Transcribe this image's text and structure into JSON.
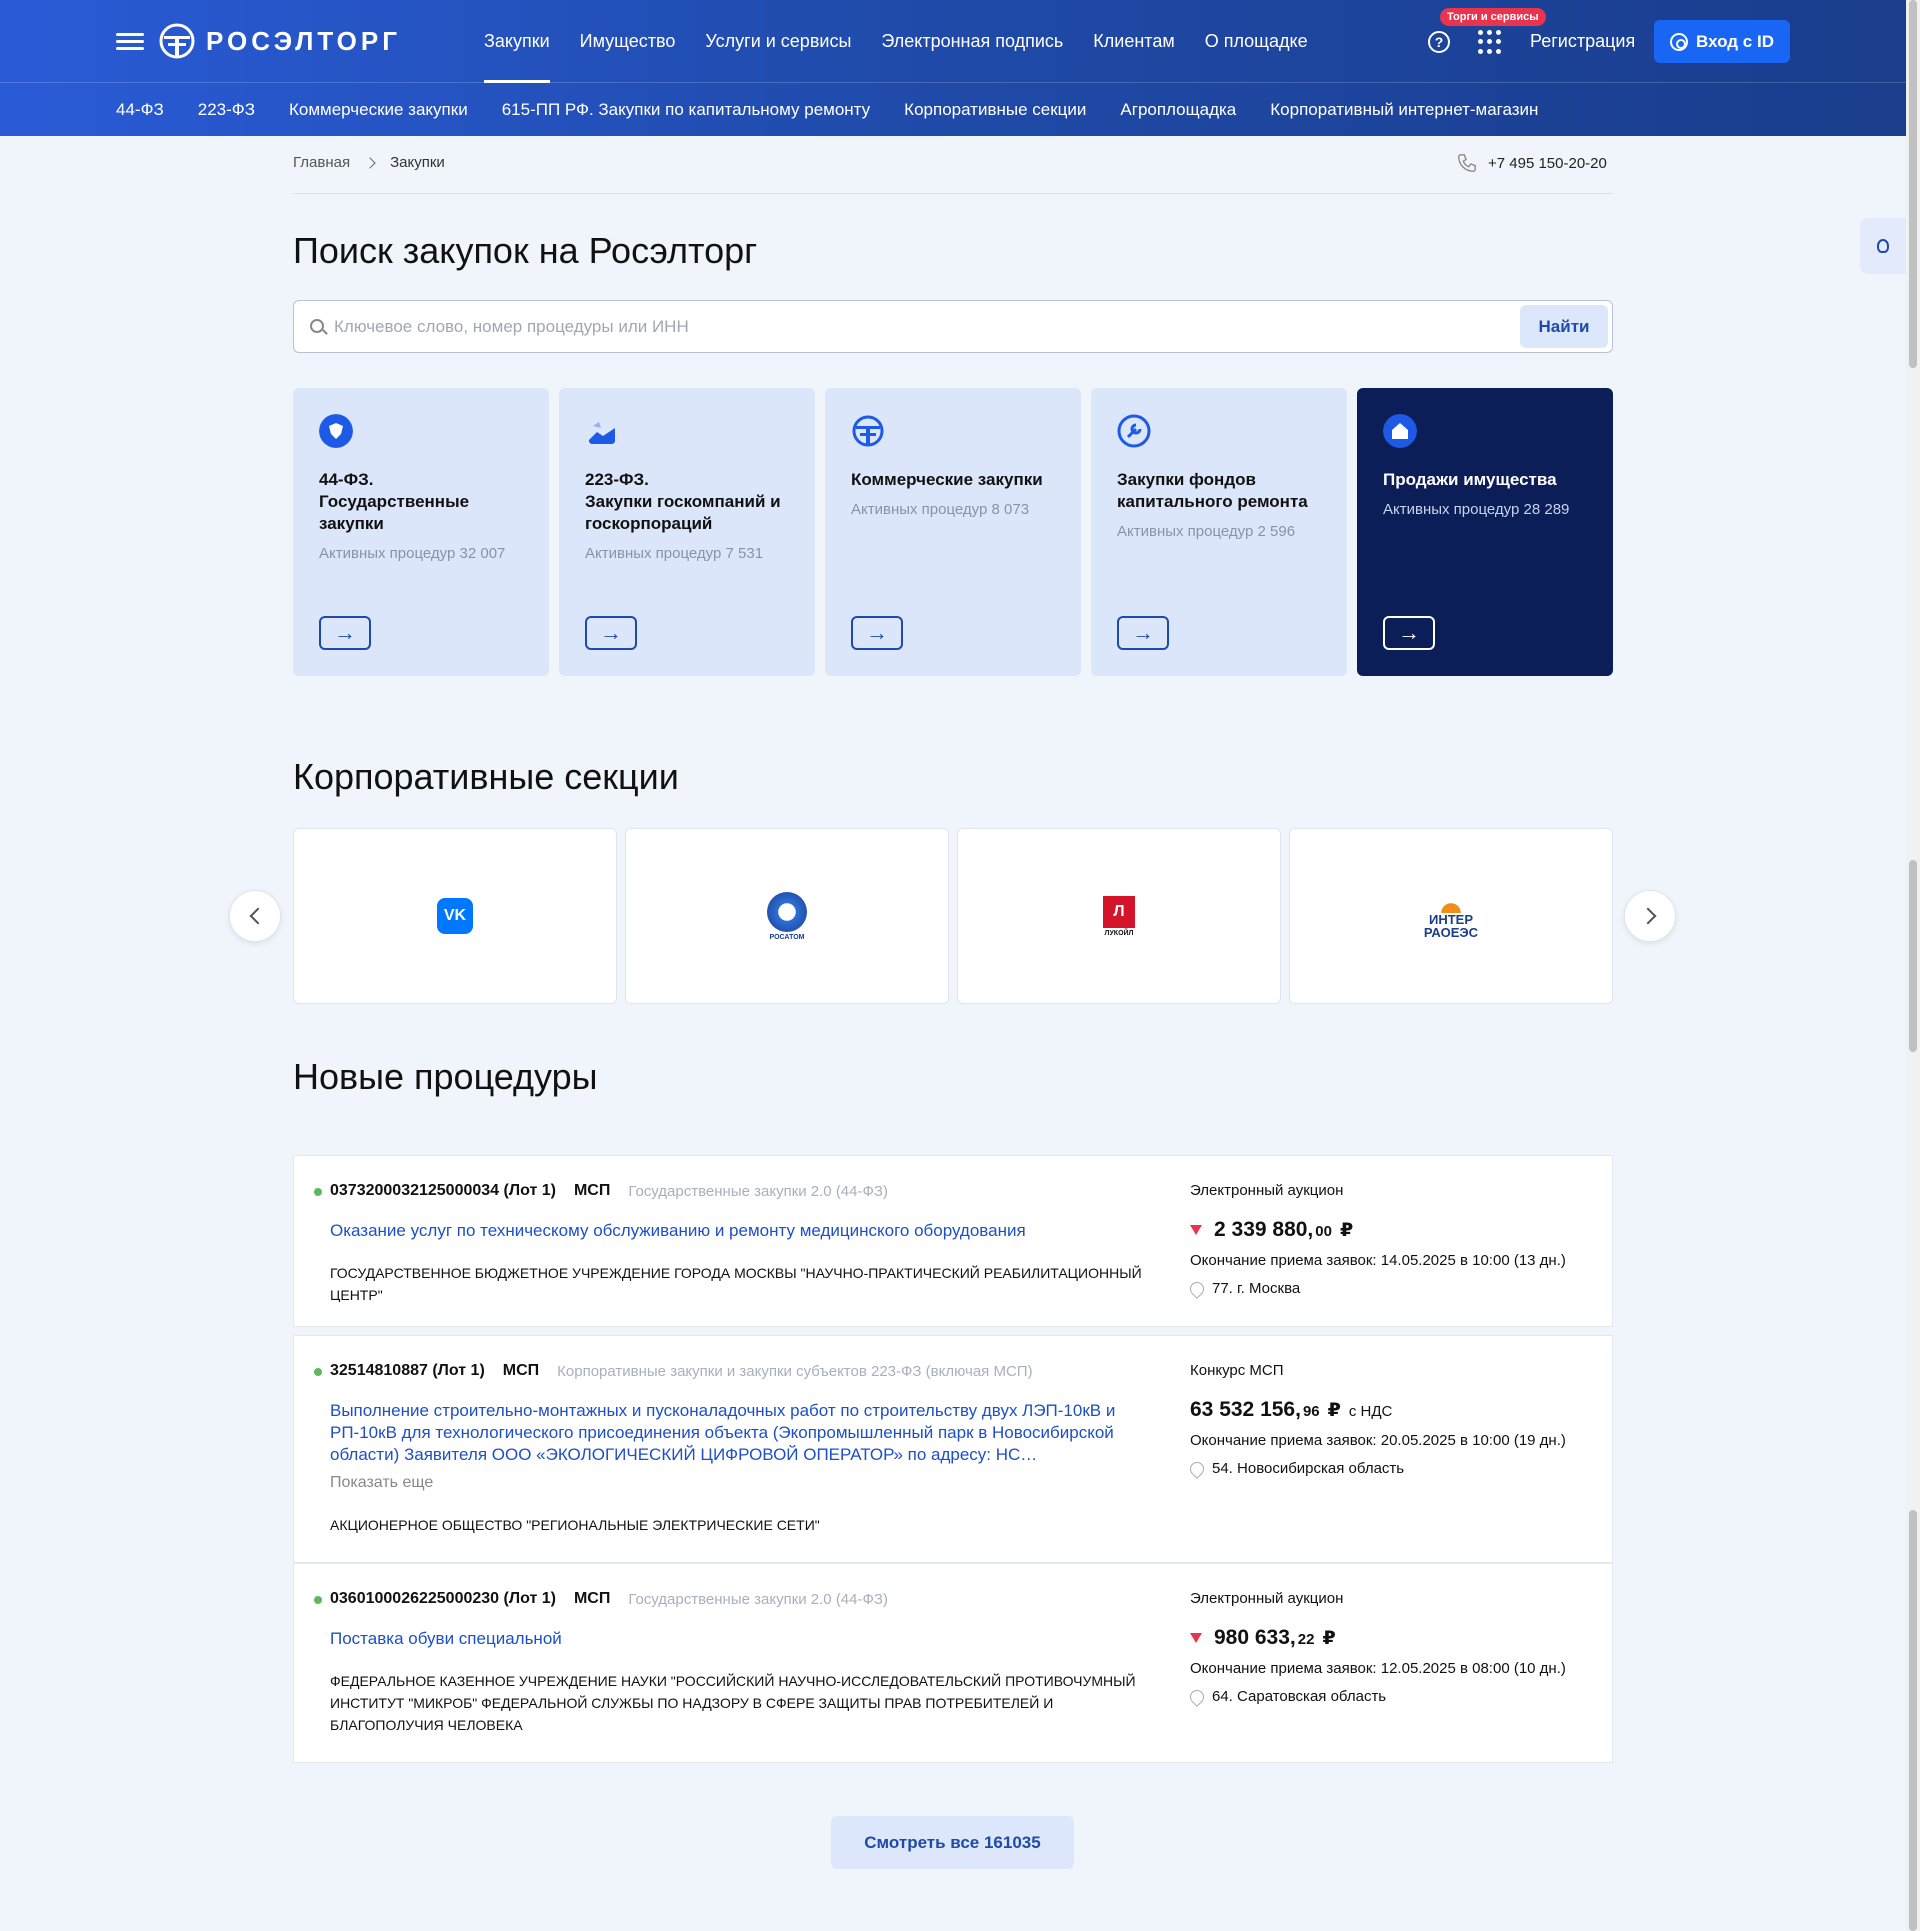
{
  "header": {
    "logo_text": "РОСЭЛТОРГ",
    "nav": [
      "Закупки",
      "Имущество",
      "Услуги и сервисы",
      "Электронная подпись",
      "Клиентам",
      "О площадке"
    ],
    "badge": "Торги и сервисы",
    "register": "Регистрация",
    "login": "Вход с ID"
  },
  "subnav": [
    "44-ФЗ",
    "223-ФЗ",
    "Коммерческие закупки",
    "615-ПП РФ. Закупки по капитальному ремонту",
    "Корпоративные секции",
    "Агроплощадка",
    "Корпоративный интернет-магазин"
  ],
  "breadcrumb": {
    "home": "Главная",
    "current": "Закупки"
  },
  "phone": "+7 495 150-20-20",
  "search": {
    "title": "Поиск закупок на Росэлторг",
    "placeholder": "Ключевое слово, номер процедуры или ИНН",
    "button": "Найти"
  },
  "cards": [
    {
      "title": "44-ФЗ.\nГосударственные закупки",
      "sub": "Активных процедур 32 007"
    },
    {
      "title": "223-ФЗ.\nЗакупки госкомпаний и госкорпораций",
      "sub": "Активных процедур 7 531"
    },
    {
      "title": "Коммерческие закупки",
      "sub": "Активных процедур 8 073"
    },
    {
      "title": "Закупки фондов капитального ремонта",
      "sub": "Активных процедур 2 596"
    },
    {
      "title": "Продажи имущества",
      "sub": "Активных процедур 28 289"
    }
  ],
  "corporate": {
    "title": "Корпоративные секции",
    "logos": [
      "VK",
      "РОСАТОМ",
      "ЛУКОЙЛ",
      "ИНТЕР РАОЕЭС"
    ]
  },
  "procedures": {
    "title": "Новые процедуры",
    "items": [
      {
        "number": "0373200032125000034 (Лот 1)",
        "msp": "МСП",
        "law": "Государственные закупки 2.0 (44-ФЗ)",
        "title": "Оказание услуг по техническому обслуживанию и ремонту медицинского оборудования",
        "org": "ГОСУДАРСТВЕННОЕ БЮДЖЕТНОЕ УЧРЕЖДЕНИЕ ГОРОДА МОСКВЫ \"НАУЧНО-ПРАКТИЧЕСКИЙ РЕАБИЛИТАЦИОННЫЙ ЦЕНТР\"",
        "type": "Электронный аукцион",
        "price_main": "2 339 880,",
        "price_cents": "00",
        "currency": "₽",
        "deadline": "Окончание приема заявок: 14.05.2025 в 10:00 (13 дн.)",
        "region": "77. г. Москва"
      },
      {
        "number": "32514810887 (Лот 1)",
        "msp": "МСП",
        "law": "Корпоративные закупки и закупки субъектов 223-ФЗ (включая МСП)",
        "title": "Выполнение строительно-монтажных и пусконаладочных работ по строительству двух ЛЭП-10кВ и РП-10кВ для технологического присоединения объекта (Экопромышленный парк в Новосибирской области) Заявителя ООО «ЭКОЛОГИЧЕСКИЙ ЦИФРОВОЙ ОПЕРАТОР» по адресу: НС…",
        "more": "Показать еще",
        "org": "АКЦИОНЕРНОЕ ОБЩЕСТВО \"РЕГИОНАЛЬНЫЕ ЭЛЕКТРИЧЕСКИЕ СЕТИ\"",
        "type": "Конкурс МСП",
        "price_main": "63 532 156,",
        "price_cents": "96",
        "currency": "₽",
        "vat": "с НДС",
        "deadline": "Окончание приема заявок: 20.05.2025 в 10:00 (19 дн.)",
        "region": "54. Новосибирская область"
      },
      {
        "number": "0360100026225000230 (Лот 1)",
        "msp": "МСП",
        "law": "Государственные закупки 2.0 (44-ФЗ)",
        "title": "Поставка обуви специальной",
        "org": "ФЕДЕРАЛЬНОЕ КАЗЕННОЕ УЧРЕЖДЕНИЕ НАУКИ \"РОССИЙСКИЙ НАУЧНО-ИССЛЕДОВАТЕЛЬСКИЙ ПРОТИВОЧУМНЫЙ ИНСТИТУТ \"МИКРОБ\" ФЕДЕРАЛЬНОЙ СЛУЖБЫ ПО НАДЗОРУ В СФЕРЕ ЗАЩИТЫ ПРАВ ПОТРЕБИТЕЛЕЙ И БЛАГОПОЛУЧИЯ ЧЕЛОВЕКА",
        "type": "Электронный аукцион",
        "price_main": "980 633,",
        "price_cents": "22",
        "currency": "₽",
        "deadline": "Окончание приема заявок: 12.05.2025 в 08:00 (10 дн.)",
        "region": "64. Саратовская область"
      }
    ],
    "view_all": "Смотреть все 161035"
  },
  "colors": {
    "accent": "#1866f3",
    "header": "#1f4aa8",
    "dark_card": "#0b1e57",
    "price_down": "#e8344e"
  }
}
